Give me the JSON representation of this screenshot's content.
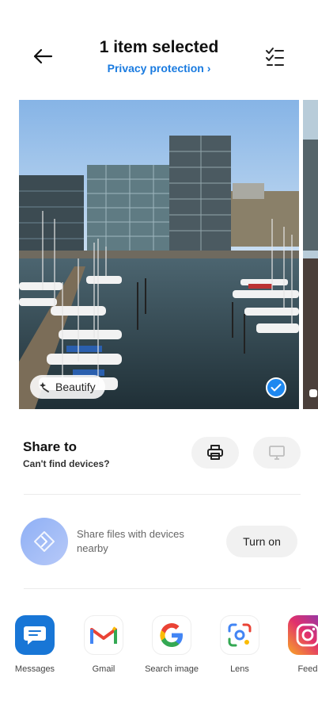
{
  "header": {
    "title": "1 item selected",
    "subtitle": "Privacy protection"
  },
  "photo": {
    "beautify_label": "Beautify",
    "selected": true
  },
  "share": {
    "title": "Share to",
    "subtitle": "Can't find devices?",
    "device_buttons": [
      "printer-icon",
      "monitor-icon"
    ]
  },
  "nearby": {
    "text": "Share files with devices nearby",
    "button_label": "Turn on"
  },
  "apps": [
    {
      "label": "Messages",
      "icon": "messages-icon"
    },
    {
      "label": "Gmail",
      "icon": "gmail-icon"
    },
    {
      "label": "Search image",
      "icon": "google-icon"
    },
    {
      "label": "Lens",
      "icon": "lens-icon"
    },
    {
      "label": "Feed",
      "icon": "instagram-icon"
    }
  ],
  "colors": {
    "accent": "#1a7be0",
    "check": "#1e88f0"
  }
}
